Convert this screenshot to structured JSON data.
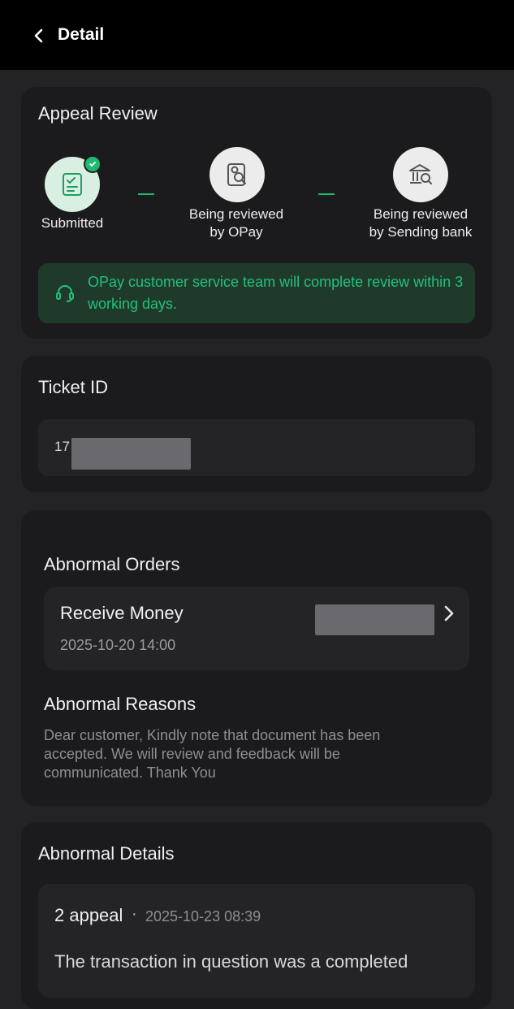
{
  "header": {
    "title": "Detail"
  },
  "appeal_review": {
    "title": "Appeal Review",
    "steps": [
      {
        "label": "Submitted",
        "status": "done",
        "icon": "document-check-icon"
      },
      {
        "label_line1": "Being reviewed",
        "label_line2": "by OPay",
        "status": "pending",
        "icon": "document-search-icon"
      },
      {
        "label_line1": "Being reviewed",
        "label_line2": "by Sending bank",
        "status": "pending",
        "icon": "bank-search-icon"
      }
    ],
    "notice": "OPay customer service team will complete review within 3 working days."
  },
  "ticket": {
    "title": "Ticket ID",
    "value_prefix": "17"
  },
  "abnormal_orders": {
    "title": "Abnormal Orders",
    "order": {
      "type": "Receive Money",
      "datetime": "2025-10-20 14:00"
    }
  },
  "abnormal_reasons": {
    "title": "Abnormal Reasons",
    "text": "Dear customer, Kindly note that document has been accepted. We will review and feedback will be communicated. Thank You"
  },
  "abnormal_details": {
    "title": "Abnormal Details",
    "appeal": {
      "label": "2 appeal",
      "separator": "·",
      "datetime": "2025-10-23 08:39",
      "text": "The transaction in question was a completed"
    }
  },
  "colors": {
    "accent": "#1dbb71",
    "background": "#232326",
    "card": "#1b1b1d"
  }
}
